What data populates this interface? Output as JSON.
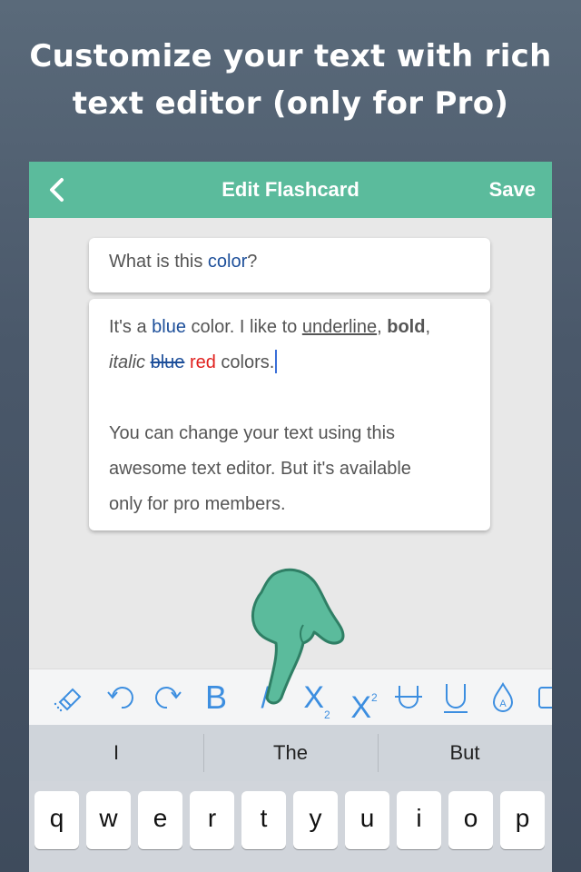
{
  "promo": {
    "line1": "Customize your text with rich",
    "line2": "text editor (only for Pro)"
  },
  "navbar": {
    "title": "Edit Flashcard",
    "save_label": "Save",
    "back_icon": "chevron-left-icon",
    "color": "#5bbb9c"
  },
  "question_card": {
    "text_before": "What is this ",
    "text_colored": "color",
    "text_after": "?"
  },
  "answer_card": {
    "line1": {
      "t1": "It's a ",
      "blue_word": "blue",
      "t2": " color. I like to ",
      "underline_word": "underline",
      "t3": ", ",
      "bold_word": "bold",
      "t4": ","
    },
    "line2": {
      "italic_word": "italic",
      "t1": " ",
      "strike_word": "blue",
      "t2": " ",
      "red_word": "red",
      "t3": " colors."
    },
    "paragraph2_lines": [
      "You can change your text using this",
      "awesome text editor. But it's available",
      "only for pro members."
    ]
  },
  "toolbar": {
    "items": [
      {
        "icon": "eraser-icon"
      },
      {
        "icon": "undo-icon"
      },
      {
        "icon": "redo-icon"
      },
      {
        "icon": "bold-icon",
        "label": "B"
      },
      {
        "icon": "italic-icon",
        "label": "/"
      },
      {
        "icon": "subscript-icon",
        "label": "X",
        "sub": "2"
      },
      {
        "icon": "superscript-icon",
        "label": "X",
        "sup": "2"
      },
      {
        "icon": "strikethrough-icon"
      },
      {
        "icon": "underline-icon"
      },
      {
        "icon": "text-color-icon"
      },
      {
        "icon": "background-color-icon"
      }
    ],
    "accent": "#3c8ee0"
  },
  "suggestions": [
    "I",
    "The",
    "But"
  ],
  "keyboard": {
    "row1": [
      "q",
      "w",
      "e",
      "r",
      "t",
      "y",
      "u",
      "i",
      "o",
      "p"
    ]
  }
}
